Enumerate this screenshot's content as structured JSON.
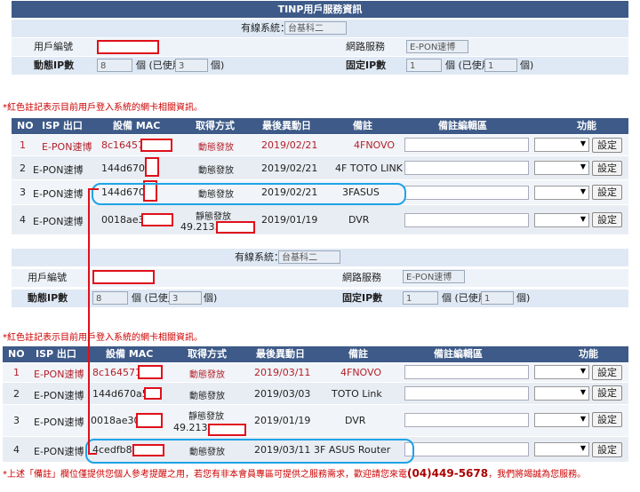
{
  "section1": {
    "title": "TINP用戶服務資訊",
    "cable_label": "有線系統：",
    "cable_value": "台基科二",
    "user_id_label": "用戶編號",
    "network_label": "網路服務",
    "network_value": "E-PON速博",
    "dyn_ip_label": "動態IP數",
    "dyn_ip_value": "8",
    "dyn_ip_mid": "個 (已使用",
    "dyn_ip_used": "3",
    "dyn_ip_end": "個)",
    "fixed_ip_label": "固定IP數",
    "fixed_ip_value": "1",
    "fixed_ip_mid": "個 (已使用",
    "fixed_ip_used": "1",
    "fixed_ip_end": "個)",
    "note": "*紅色註記表示目前用戶登入系統的網卡相關資訊。"
  },
  "table_headers": {
    "no": "NO",
    "isp": "ISP 出口",
    "mac": "設備 MAC",
    "method": "取得方式",
    "date": "最後異動日",
    "remark": "備註",
    "edit": "備註編輯區",
    "func": "功能"
  },
  "table1": [
    {
      "no": "1",
      "isp": "E-PON速博",
      "mac": "8c16457",
      "method": "動態發放",
      "date": "2019/02/21",
      "remark": "4FNOVO",
      "btn": "設定"
    },
    {
      "no": "2",
      "isp": "E-PON速博",
      "mac": "144d670a5",
      "method": "動態發放",
      "date": "2019/02/21",
      "remark": "4F TOTO LINK",
      "btn": "設定"
    },
    {
      "no": "3",
      "isp": "E-PON速博",
      "mac": "144d670a4",
      "method": "動態發放",
      "date": "2019/02/21",
      "remark": "3FASUS",
      "btn": "設定"
    },
    {
      "no": "4",
      "isp": "E-PON速博",
      "mac": "0018ae3",
      "method": "靜態發放",
      "ip": "49.213.",
      "date": "2019/01/19",
      "remark": "DVR",
      "btn": "設定"
    }
  ],
  "section2": {
    "cable_label": "有線系統：",
    "cable_value": "台基科二",
    "user_id_label": "用戶編號",
    "network_label": "網路服務",
    "network_value": "E-PON速博",
    "dyn_ip_label": "動態IP數",
    "dyn_ip_value": "8",
    "dyn_ip_mid": "個 (已使用",
    "dyn_ip_used": "3",
    "dyn_ip_end": "個)",
    "fixed_ip_label": "固定IP數",
    "fixed_ip_value": "1",
    "fixed_ip_mid": "個 (已使用",
    "fixed_ip_used": "1",
    "fixed_ip_end": "個)",
    "note": "*紅色註記表示目前用戶登入系統的網卡相關資訊。"
  },
  "table2": [
    {
      "no": "1",
      "isp": "E-PON速博",
      "mac": "8c164571",
      "method": "動態發放",
      "date": "2019/03/11",
      "remark": "4FNOVO",
      "btn": "設定"
    },
    {
      "no": "2",
      "isp": "E-PON速博",
      "mac": "144d670a5",
      "method": "動態發放",
      "date": "2019/03/03",
      "remark": "TOTO Link",
      "btn": "設定"
    },
    {
      "no": "3",
      "isp": "E-PON速博",
      "mac": "0018ae30",
      "method": "靜態發放",
      "ip": "49.213",
      "date": "2019/01/19",
      "remark": "DVR",
      "btn": "設定"
    },
    {
      "no": "4",
      "isp": "E-PON速博",
      "mac": "4cedfb8",
      "method": "動態發放",
      "date": "2019/03/11",
      "remark": "3F ASUS Router",
      "btn": "設定"
    }
  ],
  "footer": {
    "text_a": "*上述「備註」欄位僅提供您個人參考提醒之用，若您有非本會員專區可提供之服務需求，歡迎請您來電",
    "phone": "(04)449-5678",
    "text_b": "，我們將竭誠為您服務。"
  }
}
